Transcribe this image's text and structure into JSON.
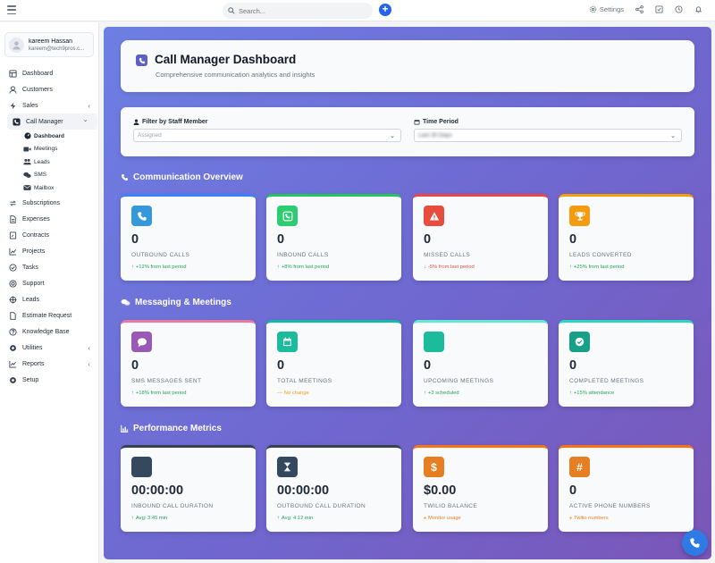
{
  "topbar": {
    "search_placeholder": "Search...",
    "settings_label": "Settings"
  },
  "user": {
    "name": "kareem Hassan",
    "email": "kareem@tech9pros.c..."
  },
  "sidebar": {
    "items": [
      {
        "label": "Dashboard",
        "icon": "dashboard-icon"
      },
      {
        "label": "Customers",
        "icon": "user-icon"
      },
      {
        "label": "Sales",
        "icon": "bolt-icon",
        "expandable": true
      },
      {
        "label": "Call Manager",
        "icon": "phone-icon",
        "expanded": true
      },
      {
        "label": "Subscriptions",
        "icon": "refresh-icon"
      },
      {
        "label": "Expenses",
        "icon": "file-icon"
      },
      {
        "label": "Contracts",
        "icon": "contract-icon"
      },
      {
        "label": "Projects",
        "icon": "chart-icon"
      },
      {
        "label": "Tasks",
        "icon": "check-circle-icon"
      },
      {
        "label": "Support",
        "icon": "lifebuoy-icon"
      },
      {
        "label": "Leads",
        "icon": "target-icon"
      },
      {
        "label": "Estimate Request",
        "icon": "document-icon"
      },
      {
        "label": "Knowledge Base",
        "icon": "question-icon"
      },
      {
        "label": "Utilities",
        "icon": "gear-icon",
        "expandable": true
      },
      {
        "label": "Reports",
        "icon": "line-chart-icon",
        "expandable": true
      },
      {
        "label": "Setup",
        "icon": "gear-icon"
      }
    ],
    "sub_items": [
      {
        "label": "Dashboard",
        "icon": "gauge-icon",
        "active": true
      },
      {
        "label": "Meetings",
        "icon": "video-icon"
      },
      {
        "label": "Leads",
        "icon": "users-icon"
      },
      {
        "label": "SMS",
        "icon": "chat-icon"
      },
      {
        "label": "Mailbox",
        "icon": "mail-icon"
      }
    ]
  },
  "header": {
    "title": "Call Manager Dashboard",
    "subtitle": "Comprehensive communication analytics and insights"
  },
  "filters": {
    "staff_label": "Filter by Staff Member",
    "staff_value": "Assigned",
    "period_label": "Time Period",
    "period_value": "Last 30 Days"
  },
  "sections": {
    "communication": "Communication Overview",
    "messaging": "Messaging & Meetings",
    "performance": "Performance Metrics"
  },
  "cards": {
    "communication": [
      {
        "value": "0",
        "label": "OUTBOUND CALLS",
        "trend": "+12% from last period",
        "trend_dir": "up",
        "color": "#3498db",
        "border": "#3b82f6",
        "icon": "phone-icon"
      },
      {
        "value": "0",
        "label": "INBOUND CALLS",
        "trend": "+8% from last period",
        "trend_dir": "up",
        "color": "#2ecc71",
        "border": "#22c55e",
        "icon": "phone-square-icon"
      },
      {
        "value": "0",
        "label": "MISSED CALLS",
        "trend": "-5% from last period",
        "trend_dir": "down",
        "color": "#e74c3c",
        "border": "#ef4444",
        "icon": "warning-icon"
      },
      {
        "value": "0",
        "label": "LEADS CONVERTED",
        "trend": "+25% from last period",
        "trend_dir": "up",
        "color": "#f39c12",
        "border": "#f59e0b",
        "icon": "trophy-icon"
      }
    ],
    "messaging": [
      {
        "value": "0",
        "label": "SMS MESSAGES SENT",
        "trend": "+18% from last period",
        "trend_dir": "up",
        "color": "#9b59b6",
        "border": "#e879a0",
        "icon": "message-icon"
      },
      {
        "value": "0",
        "label": "TOTAL MEETINGS",
        "trend": "No change",
        "trend_dir": "flat",
        "color": "#1abc9c",
        "border": "#14b8a6",
        "icon": "calendar-icon"
      },
      {
        "value": "0",
        "label": "UPCOMING MEETINGS",
        "trend": "+3 scheduled",
        "trend_dir": "up",
        "color": "#1abc9c",
        "border": "#5eead4",
        "icon": "clock-icon"
      },
      {
        "value": "0",
        "label": "COMPLETED MEETINGS",
        "trend": "+15% attendance",
        "trend_dir": "up",
        "color": "#16a085",
        "border": "#2dd4bf",
        "icon": "check-circle-icon"
      }
    ],
    "performance": [
      {
        "value": "00:00:00",
        "label": "INBOUND CALL DURATION",
        "trend": "Avg: 3:45 min",
        "trend_dir": "up",
        "color": "#34495e",
        "border": "#374151",
        "icon": "stopwatch-icon"
      },
      {
        "value": "00:00:00",
        "label": "OUTBOUND CALL DURATION",
        "trend": "Avg: 4:12 min",
        "trend_dir": "up",
        "color": "#34495e",
        "border": "#374151",
        "icon": "hourglass-icon"
      },
      {
        "value": "$0.00",
        "label": "TWILIO BALANCE",
        "trend": "Monitor usage",
        "trend_dir": "info",
        "color": "#e67e22",
        "border": "#f97316",
        "icon": "dollar-icon"
      },
      {
        "value": "0",
        "label": "ACTIVE PHONE NUMBERS",
        "trend": "Twilio numbers",
        "trend_dir": "info",
        "color": "#e67e22",
        "border": "#f97316",
        "icon": "hash-icon"
      }
    ]
  },
  "colors": {
    "up": "#22a35a",
    "down": "#e0533f",
    "flat": "#f39c12",
    "info": "#f39c12",
    "accent": "#2563eb"
  }
}
